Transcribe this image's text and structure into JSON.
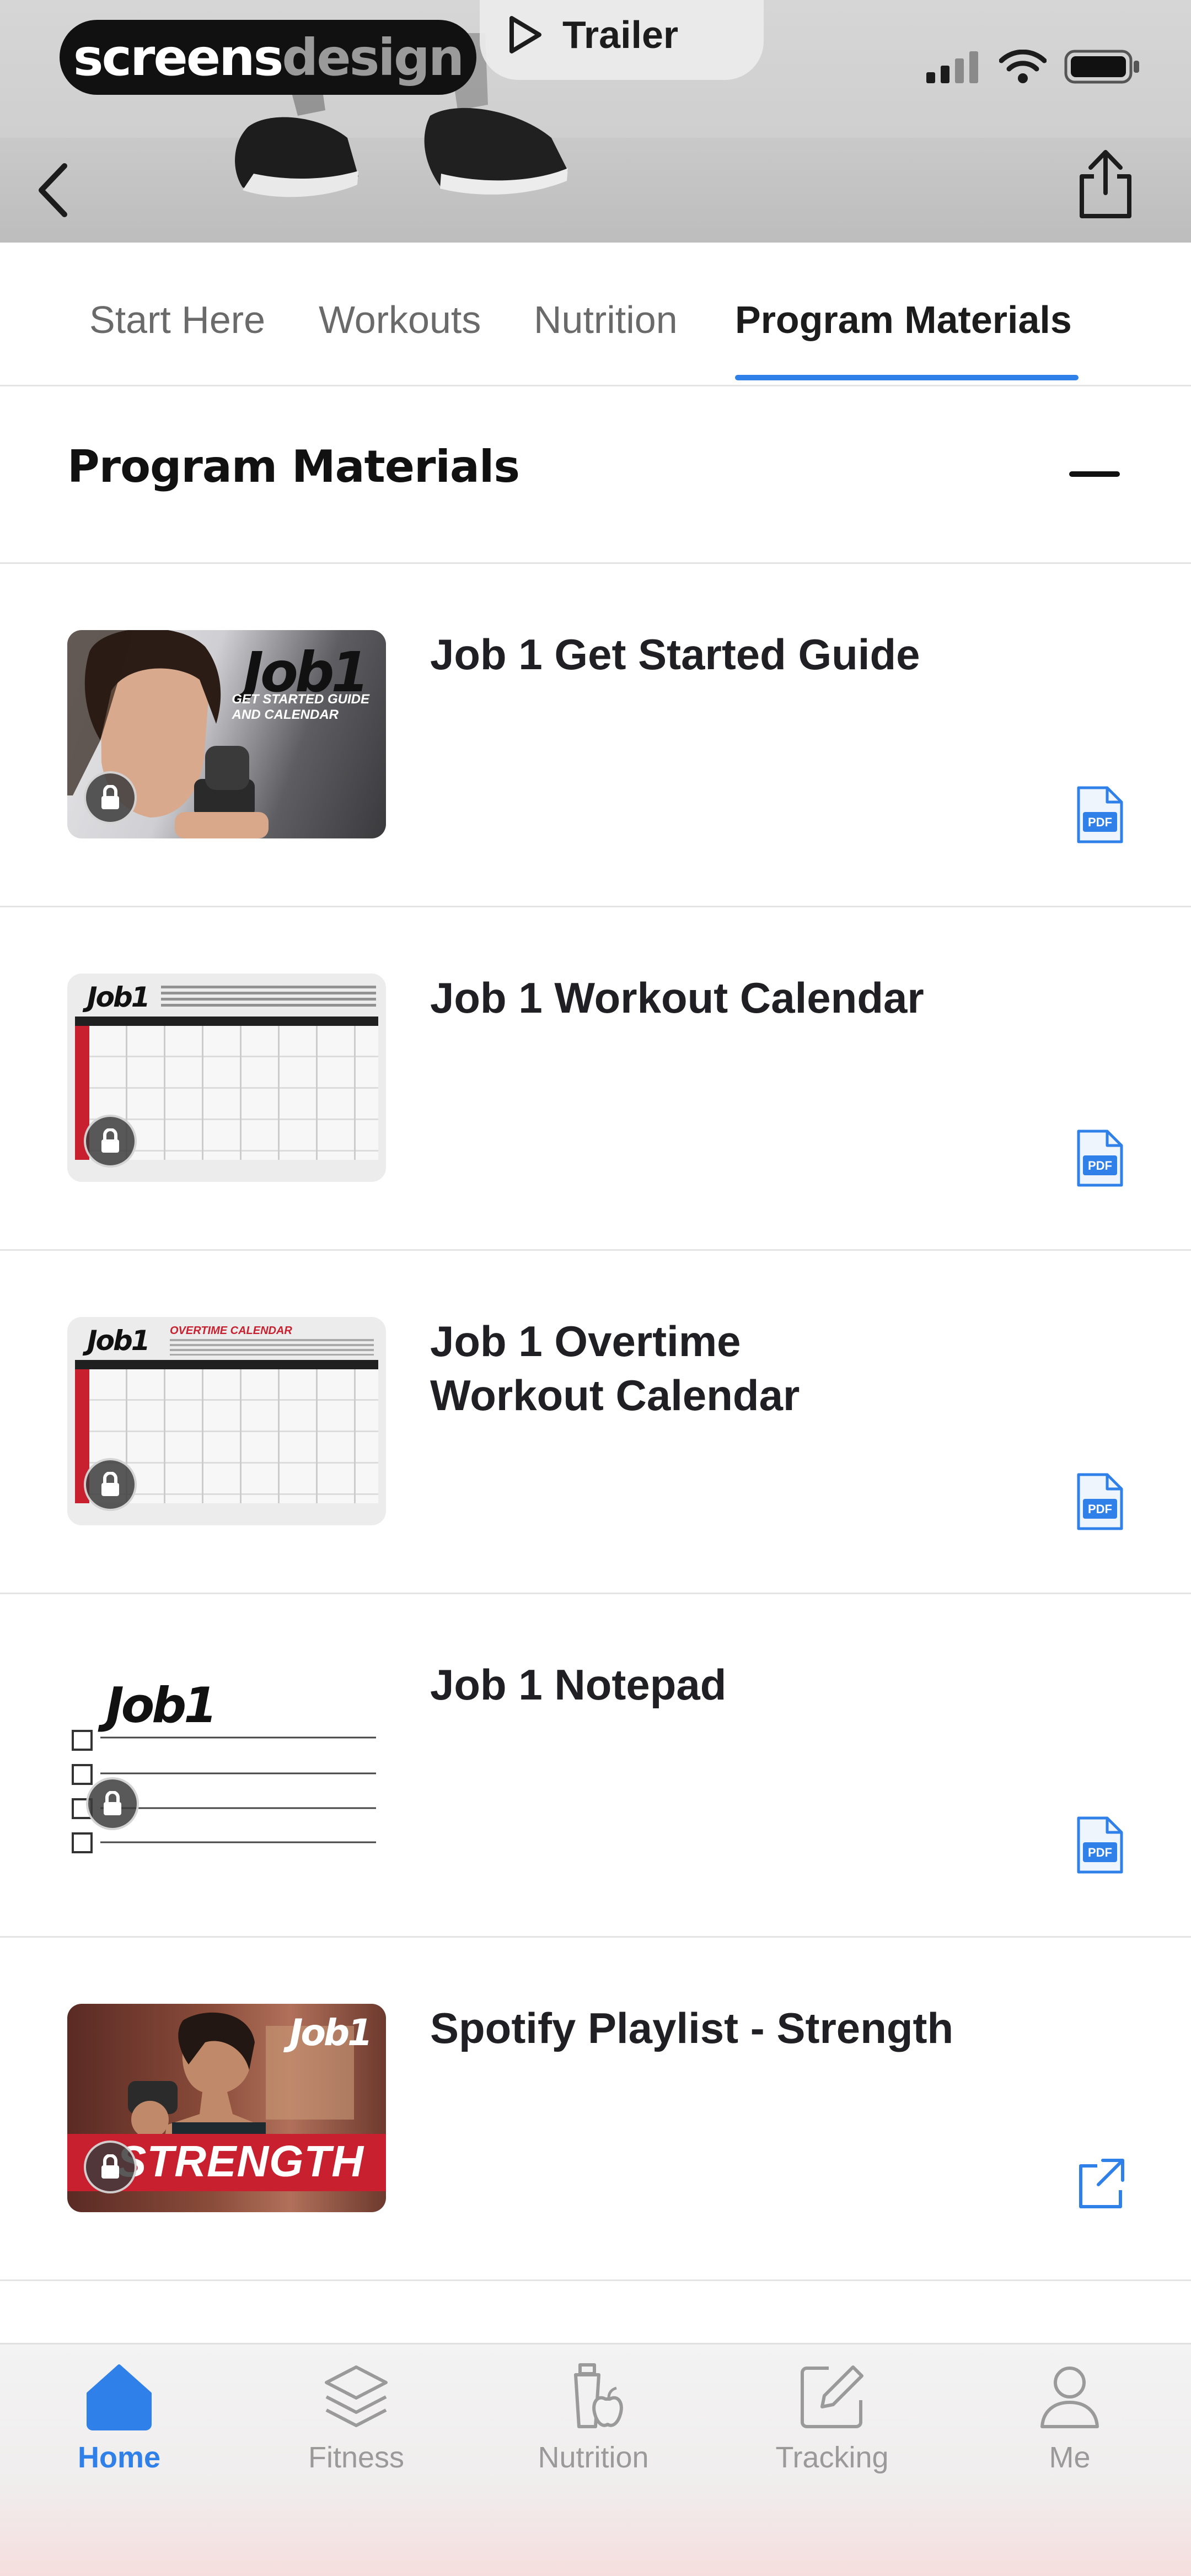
{
  "status_bar": {
    "brand": {
      "part1": "screens",
      "part2": "design"
    },
    "trailer_label": "Trailer"
  },
  "tabs": [
    {
      "label": "Start Here",
      "active": false
    },
    {
      "label": "Workouts",
      "active": false
    },
    {
      "label": "Nutrition",
      "active": false
    },
    {
      "label": "Program Materials",
      "active": true
    }
  ],
  "section": {
    "title": "Program Materials"
  },
  "items": [
    {
      "title": "Job 1 Get Started Guide",
      "type_icon": "pdf-icon",
      "type_label": "PDF",
      "thumb_logo": "Job1",
      "thumb_caption_1": "GET STARTED GUIDE",
      "thumb_caption_2": "AND CALENDAR",
      "locked": true
    },
    {
      "title": "Job 1 Workout Calendar",
      "type_icon": "pdf-icon",
      "type_label": "PDF",
      "thumb_logo": "Job1",
      "locked": true
    },
    {
      "title": "Job 1 Overtime Workout Calendar",
      "type_icon": "pdf-icon",
      "type_label": "PDF",
      "thumb_logo": "Job1",
      "thumb_caption_1": "OVERTIME CALENDAR",
      "locked": true
    },
    {
      "title": "Job 1 Notepad",
      "type_icon": "pdf-icon",
      "type_label": "PDF",
      "thumb_logo": "Job1",
      "locked": true
    },
    {
      "title": "Spotify Playlist - Strength",
      "type_icon": "external-link-icon",
      "thumb_logo": "Job1",
      "thumb_caption_1": "STRENGTH",
      "locked": true
    }
  ],
  "tabbar": [
    {
      "label": "Home",
      "icon": "home-icon",
      "active": true
    },
    {
      "label": "Fitness",
      "icon": "layers-icon",
      "active": false
    },
    {
      "label": "Nutrition",
      "icon": "shaker-apple-icon",
      "active": false
    },
    {
      "label": "Tracking",
      "icon": "edit-icon",
      "active": false
    },
    {
      "label": "Me",
      "icon": "person-icon",
      "active": false
    }
  ],
  "colors": {
    "accent": "#2f80e8",
    "brand_red": "#c8202f",
    "text": "#1f1f24",
    "muted": "#9a9a9a"
  }
}
